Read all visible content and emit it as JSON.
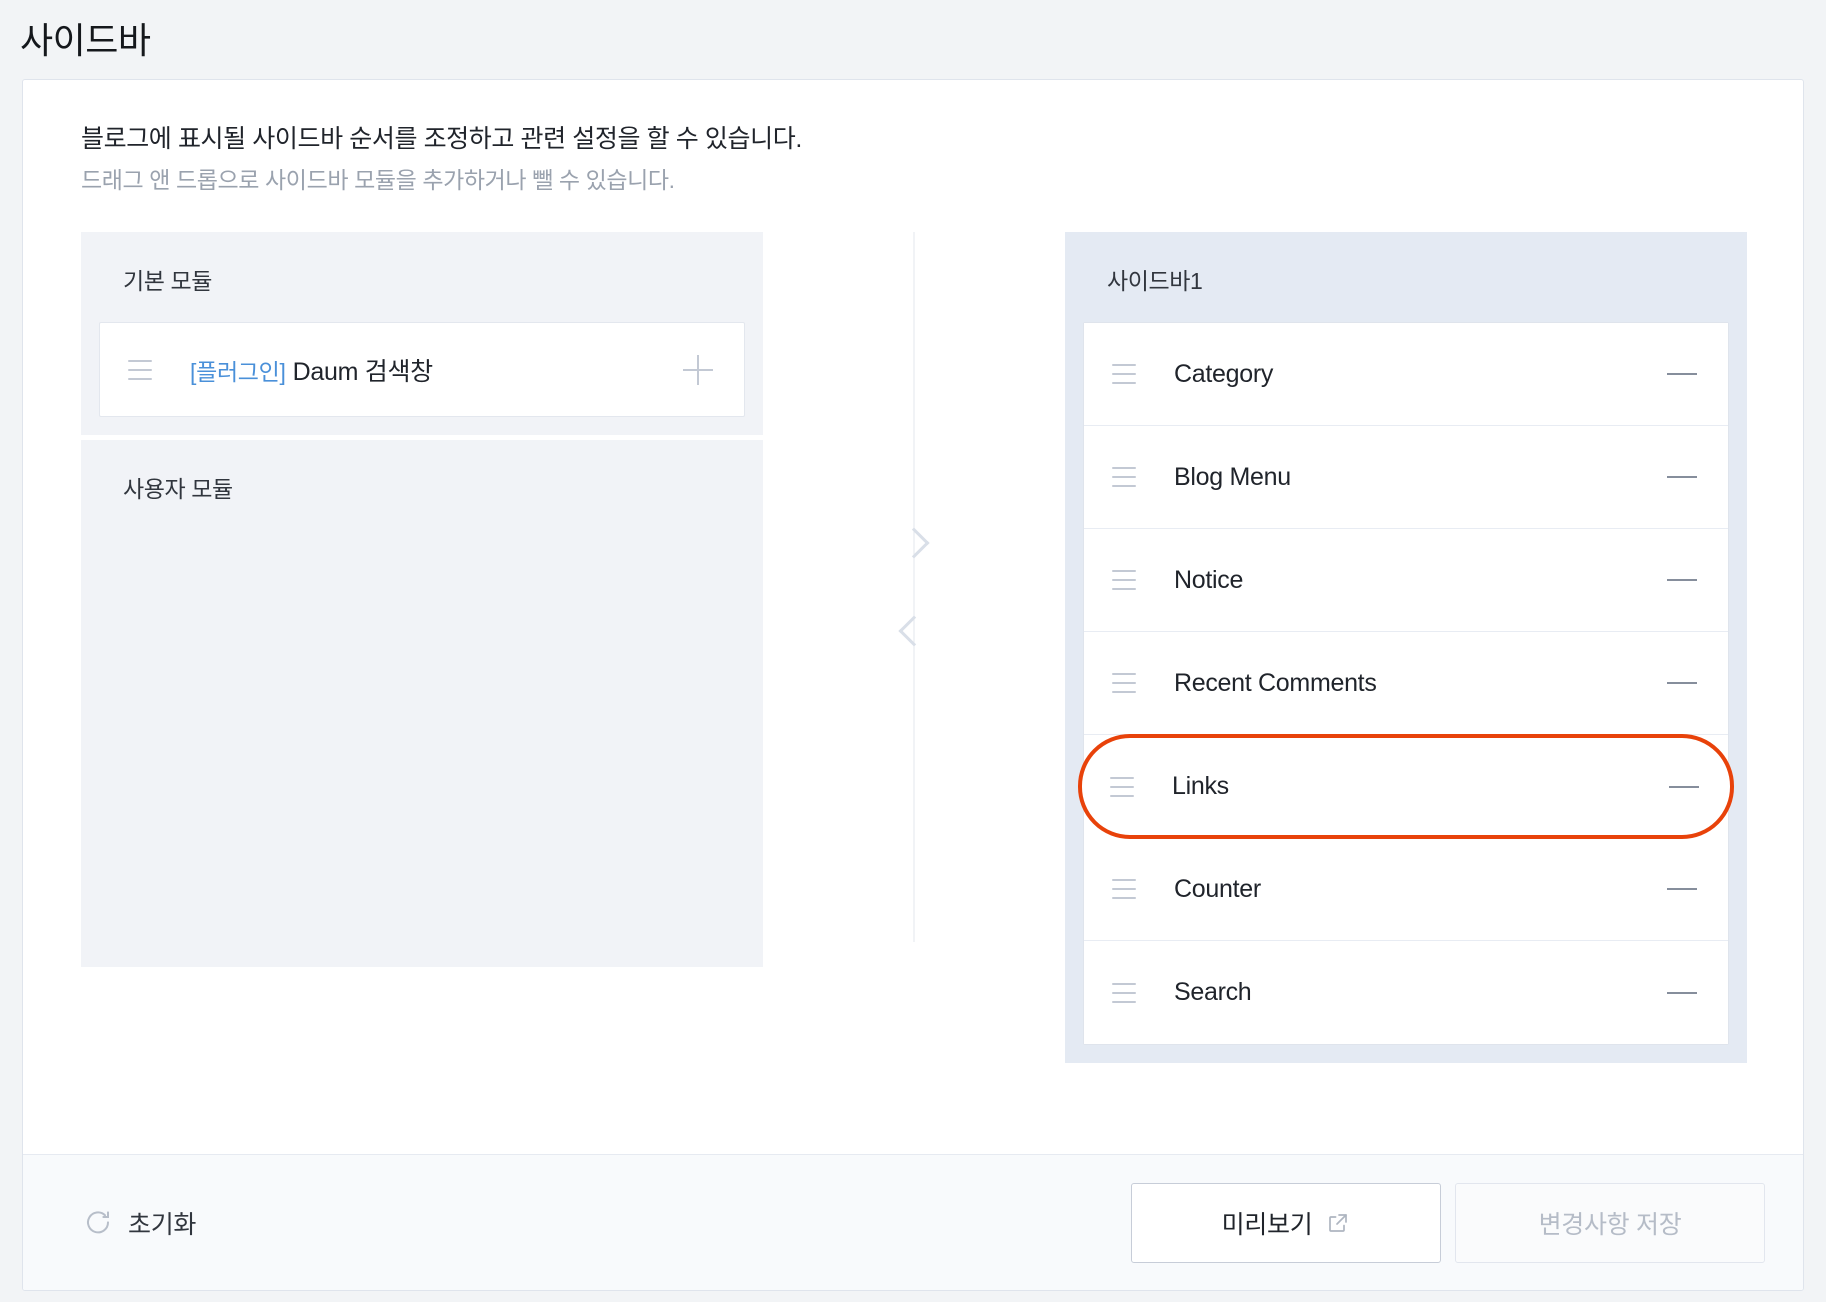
{
  "page": {
    "title": "사이드바"
  },
  "intro": {
    "primary": "블로그에 표시될 사이드바 순서를 조정하고 관련 설정을 할 수 있습니다.",
    "secondary": "드래그 앤 드롭으로 사이드바 모듈을 추가하거나 뺄 수 있습니다."
  },
  "left_panel": {
    "basic_group": {
      "title": "기본 모듈",
      "modules": [
        {
          "tag": "[플러그인]",
          "label": "Daum 검색창",
          "action_icon": "plus-icon",
          "drag_icon": "drag-handle-icon"
        }
      ]
    },
    "user_group": {
      "title": "사용자 모듈",
      "modules": []
    }
  },
  "transfer": {
    "move_right_icon": "chevron-right-icon",
    "move_left_icon": "chevron-left-icon"
  },
  "right_panel": {
    "title": "사이드바1",
    "items": [
      {
        "label": "Category",
        "action_icon": "minus-icon",
        "highlighted": false
      },
      {
        "label": "Blog Menu",
        "action_icon": "minus-icon",
        "highlighted": false
      },
      {
        "label": "Notice",
        "action_icon": "minus-icon",
        "highlighted": false
      },
      {
        "label": "Recent Comments",
        "action_icon": "minus-icon",
        "highlighted": false
      },
      {
        "label": "Links",
        "action_icon": "minus-icon",
        "highlighted": true
      },
      {
        "label": "Counter",
        "action_icon": "minus-icon",
        "highlighted": false
      },
      {
        "label": "Search",
        "action_icon": "minus-icon",
        "highlighted": false
      }
    ]
  },
  "footer": {
    "reset_label": "초기화",
    "reset_icon": "refresh-icon",
    "preview_label": "미리보기",
    "preview_icon": "external-link-icon",
    "save_label": "변경사항 저장",
    "save_disabled": true
  },
  "colors": {
    "page_background": "#f2f4f6",
    "card_background": "#ffffff",
    "panel_background": "#f1f3f7",
    "sidebar_panel_background": "#e4eaf3",
    "highlight_outline": "#e8420a",
    "plugin_tag": "#4a90d9",
    "muted_text": "#9aa2ae"
  }
}
